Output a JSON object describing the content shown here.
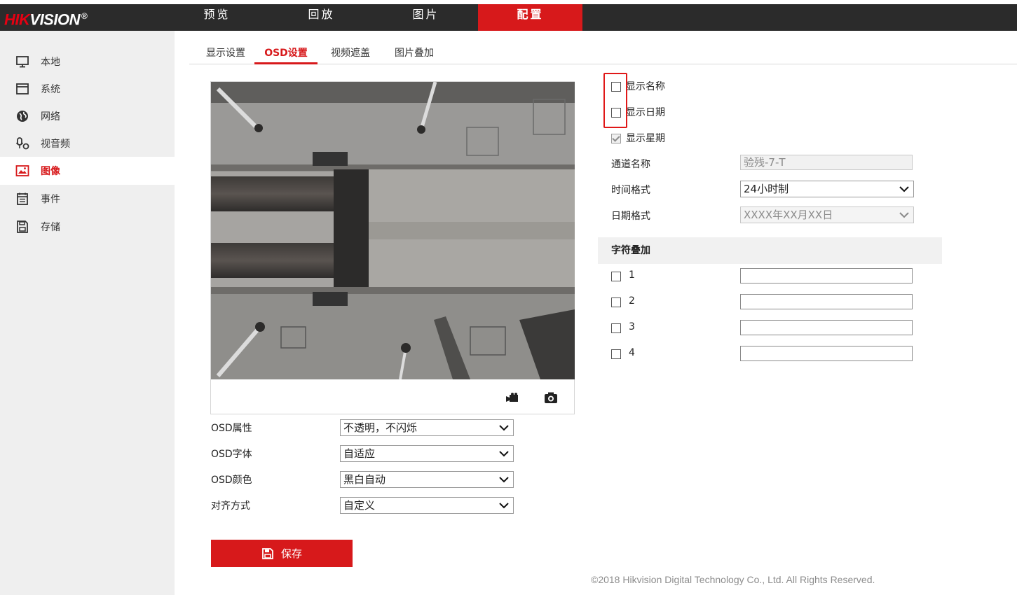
{
  "brand": {
    "logo_part1": "HIK",
    "logo_part2": "VISION",
    "logo_reg": "®"
  },
  "topnav": [
    {
      "label": "预览"
    },
    {
      "label": "回放"
    },
    {
      "label": "图片"
    },
    {
      "label": "配置",
      "active": true
    }
  ],
  "sidebar": {
    "items": [
      {
        "label": "本地",
        "icon": "monitor-icon"
      },
      {
        "label": "系统",
        "icon": "system-window-icon"
      },
      {
        "label": "网络",
        "icon": "globe-icon"
      },
      {
        "label": "视音频",
        "icon": "audio-video-icon"
      },
      {
        "label": "图像",
        "icon": "image-icon",
        "active": true
      },
      {
        "label": "事件",
        "icon": "event-calendar-icon"
      },
      {
        "label": "存储",
        "icon": "storage-icon"
      }
    ]
  },
  "tabs": [
    {
      "label": "显示设置"
    },
    {
      "label": "OSD设置",
      "active": true
    },
    {
      "label": "视频遮盖"
    },
    {
      "label": "图片叠加"
    }
  ],
  "preview": {
    "record_icon": "video-record-icon",
    "snapshot_icon": "camera-snapshot-icon"
  },
  "osd_form": {
    "attr_label": "OSD属性",
    "attr_value": "不透明，不闪烁",
    "font_label": "OSD字体",
    "font_value": "自适应",
    "color_label": "OSD颜色",
    "color_value": "黑白自动",
    "align_label": "对齐方式",
    "align_value": "自定义"
  },
  "save_label": "保存",
  "display": {
    "show_name_label": "显示名称",
    "show_name_checked": false,
    "show_date_label": "显示日期",
    "show_date_checked": false,
    "show_week_label": "显示星期",
    "show_week_checked": true,
    "channel_name_label": "通道名称",
    "channel_name_value": "验残-7-T",
    "time_format_label": "时间格式",
    "time_format_value": "24小时制",
    "date_format_label": "日期格式",
    "date_format_value": "XXXX年XX月XX日"
  },
  "overlay": {
    "title": "字符叠加",
    "rows": [
      {
        "label": "1",
        "value": ""
      },
      {
        "label": "2",
        "value": ""
      },
      {
        "label": "3",
        "value": ""
      },
      {
        "label": "4",
        "value": ""
      }
    ]
  },
  "footer": "©2018 Hikvision Digital Technology Co., Ltd. All Rights Reserved.",
  "colors": {
    "accent": "#d7191b",
    "topbar": "#2b2b2b",
    "sidebar": "#efefef",
    "highlight_box": "#e01818"
  }
}
